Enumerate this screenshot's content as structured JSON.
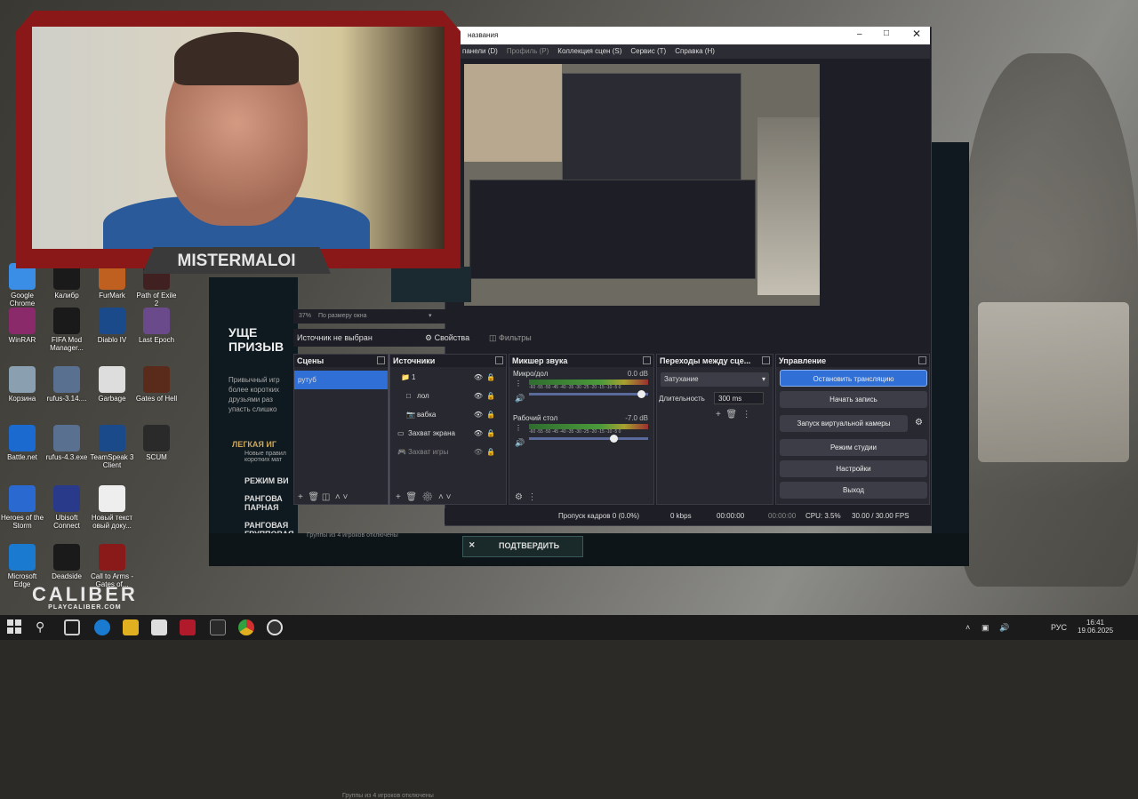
{
  "desktop_icons": [
    {
      "label": "Google Chrome",
      "color": "#3a8ee6"
    },
    {
      "label": "Калибр",
      "color": "#1a1a1a"
    },
    {
      "label": "FurMark",
      "color": "#c06020"
    },
    {
      "label": "Path of Exile 2",
      "color": "#402020"
    },
    {
      "label": "WinRAR",
      "color": "#8a2a6a"
    },
    {
      "label": "FIFA Mod Manager...",
      "color": "#1a1a1a"
    },
    {
      "label": "Diablo IV",
      "color": "#1a4a8a"
    },
    {
      "label": "Last Epoch",
      "color": "#6a4a8a"
    },
    {
      "label": "Корзина",
      "color": "#8aa0b0"
    },
    {
      "label": "rufus-3.14....",
      "color": "#5a7090"
    },
    {
      "label": "Garbage",
      "color": "#dddddd"
    },
    {
      "label": "Gates of Hell",
      "color": "#5a2a1a"
    },
    {
      "label": "Battle.net",
      "color": "#1a6ad0"
    },
    {
      "label": "rufus-4.3.exe",
      "color": "#5a7090"
    },
    {
      "label": "TeamSpeak 3 Client",
      "color": "#1a4a8a"
    },
    {
      "label": "SCUM",
      "color": "#2a2a2a"
    },
    {
      "label": "Heroes of the Storm",
      "color": "#2a6ad0"
    },
    {
      "label": "Ubisoft Connect",
      "color": "#2a3a8a"
    },
    {
      "label": "Новый текст овый доку...",
      "color": "#eeeeee"
    },
    {
      "label": "Microsoft Edge",
      "color": "#1a7ad0"
    },
    {
      "label": "Deadside",
      "color": "#1a1a1a"
    },
    {
      "label": "Call to Arms - Gates of...",
      "color": "#8a1a1a"
    }
  ],
  "cam": {
    "name": "MISTERMALOI"
  },
  "game_text": {
    "heading": "УЩЕ ПРИЗЫВ",
    "desc": "Привычный игр более коротких друзьями раз упасть слишко",
    "mode1": "ЛЕГКАЯ ИГ",
    "mode1_sub": "Новые правил коротких мат",
    "mode2": "РЕЖИМ ВИ",
    "mode3": "РАНГОВА ПАРНАЯ",
    "mode4": "РАНГОВАЯ ГРУППОВАЯ",
    "mode4_sub": "Группы из 4 игроков отключены"
  },
  "confirm_label": "ПОДТВЕРДИТЬ",
  "caliber": {
    "logo": "CALIBER",
    "site": "PLAYCALIBER.COM"
  },
  "obs": {
    "title": "названия",
    "menu": [
      "панели (D)",
      "Профиль (P)",
      "Коллекция сцен (S)",
      "Сервис (T)",
      "Справка (H)"
    ],
    "zoom": "37%",
    "zoom_mode": "По размеру окна",
    "no_source": "Источник не выбран",
    "properties": "Свойства",
    "filters": "Фильтры",
    "docks": {
      "scenes": "Сцены",
      "sources": "Источники",
      "mixer": "Микшер звука",
      "transitions": "Переходы между сце...",
      "controls": "Управление"
    },
    "scenes": [
      "рутуб"
    ],
    "sources": [
      {
        "name": "1",
        "type": "folder"
      },
      {
        "name": "лол",
        "type": "window"
      },
      {
        "name": "вабка",
        "type": "camera"
      },
      {
        "name": "Захват экрана",
        "type": "display"
      },
      {
        "name": "Захват игры",
        "type": "game"
      }
    ],
    "mixer": [
      {
        "name": "Микро/дол",
        "db": "0.0 dB",
        "level": 0.95
      },
      {
        "name": "Рабочий стол",
        "db": "-7.0 dB",
        "level": 0.72
      }
    ],
    "meter_scale": "-60 -55 -50 -45 -40 -35 -30 -25 -20 -15 -10 -5 0",
    "transition": "Затухание",
    "duration_label": "Длительность",
    "duration": "300 ms",
    "controls": [
      "Остановить трансляцию",
      "Начать запись",
      "Запуск виртуальной камеры",
      "Режим студии",
      "Настройки",
      "Выход"
    ],
    "status": {
      "dropped": "Пропуск кадров 0 (0.0%)",
      "kbps": "0 kbps",
      "stream_time": "00:00:00",
      "rec_time": "00:00:00",
      "cpu": "CPU: 3.5%",
      "fps": "30.00 / 30.00 FPS"
    }
  },
  "taskbar": {
    "lang": "РУС",
    "time": "16:41",
    "date": "19.06.2025"
  },
  "colors": {
    "accent": "#2f6fd6",
    "obs_bg": "#1e1f26",
    "cam_frame": "#8a1818"
  }
}
